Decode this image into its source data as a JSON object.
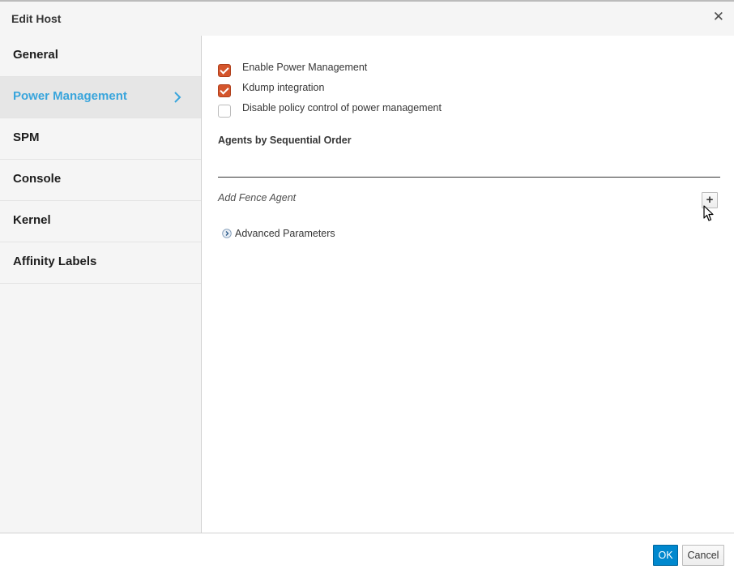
{
  "dialog": {
    "title": "Edit Host",
    "close_icon": "close-icon"
  },
  "sidebar": {
    "items": [
      {
        "label": "General",
        "active": false
      },
      {
        "label": "Power Management",
        "active": true
      },
      {
        "label": "SPM",
        "active": false
      },
      {
        "label": "Console",
        "active": false
      },
      {
        "label": "Kernel",
        "active": false
      },
      {
        "label": "Affinity Labels",
        "active": false
      }
    ],
    "active_color": "#39a5dc"
  },
  "power_management": {
    "checkboxes": [
      {
        "label": "Enable Power Management",
        "checked": true
      },
      {
        "label": "Kdump integration",
        "checked": true
      },
      {
        "label": "Disable policy control of power management",
        "checked": false
      }
    ],
    "checkbox_color": "#d4552c",
    "agents_title": "Agents by Sequential Order",
    "add_fence_agent_label": "Add Fence Agent",
    "add_button_label": "+",
    "advanced_parameters_label": "Advanced Parameters"
  },
  "footer": {
    "ok_label": "OK",
    "cancel_label": "Cancel",
    "ok_color": "#0088ce"
  }
}
